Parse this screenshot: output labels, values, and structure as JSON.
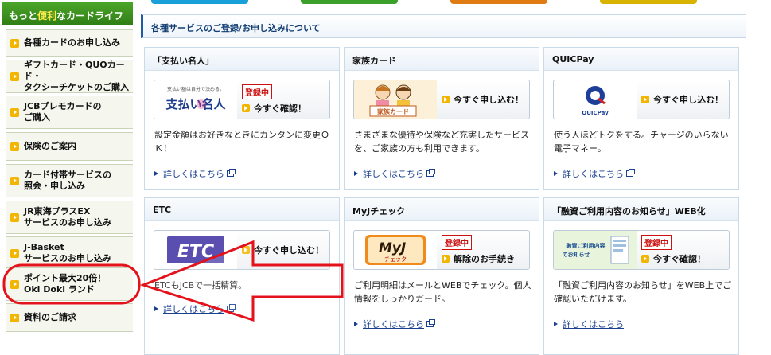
{
  "top_bars": [
    {
      "color": "#1aa0d8"
    },
    {
      "color": "#3aa02a"
    },
    {
      "color": "#e07a12"
    },
    {
      "color": "#d8b400"
    }
  ],
  "sidebar": {
    "header_prefix": "もっと",
    "header_highlight": "便利",
    "header_suffix": "なカードライフ",
    "items": [
      {
        "label": "各種カードのお申し込み"
      },
      {
        "label": "ギフトカード・QUOカード・\nタクシーチケットのご購入"
      },
      {
        "label": "JCBプレモカードの\nご購入"
      },
      {
        "label": "保険のご案内"
      },
      {
        "label": "カード付帯サービスの\n照会・申し込み"
      },
      {
        "label": "JR東海プラスEX\nサービスのお申し込み"
      },
      {
        "label": "J-Basket\nサービスのお申し込み"
      },
      {
        "label": "ポイント最大20倍！\nOki Doki ランド"
      },
      {
        "label": "資料のご請求"
      }
    ]
  },
  "main": {
    "title": "各種サービスのご登録/お申し込みについて",
    "cards": [
      {
        "title": "「支払い名人」",
        "logo_text": "支払い名人",
        "logo_tagline": "支払い額は自分で決める。",
        "badge": "登録中",
        "cta": "今すぐ確認！",
        "desc": "設定金額はお好きなときにカンタンに変更ＯＫ！",
        "link": "詳しくはこちら"
      },
      {
        "title": "家族カード",
        "logo_text": "家族カード",
        "badge": "",
        "cta": "今すぐ申し込む！",
        "desc": "さまざまな優待や保険など充実したサービスを、ご家族の方も利用できます。",
        "link": "詳しくはこちら"
      },
      {
        "title": "QUICPay",
        "logo_text": "QUICPay",
        "badge": "",
        "cta": "今すぐ申し込む！",
        "desc": "使う人ほどトクをする。チャージのいらない電子マネー。",
        "link": "詳しくはこちら"
      },
      {
        "title": "ETC",
        "logo_text": "ETC",
        "badge": "",
        "cta": "今すぐ申し込む！",
        "desc": "ETCもJCBで一括精算。",
        "link": "詳しくはこちら"
      },
      {
        "title": "MyJチェック",
        "logo_text": "MyJ",
        "logo_sub": "チェック",
        "badge": "登録中",
        "cta": "解除のお手続き",
        "desc": "ご利用明細はメールとWEBでチェック。個人情報をしっかりガード。",
        "link": "詳しくはこちら"
      },
      {
        "title": "「融資ご利用内容のお知らせ」WEB化",
        "logo_text": "融資ご利用内容\nのお知らせ",
        "badge": "登録中",
        "cta": "今すぐ確認！",
        "desc": "「融資ご利用内容のお知らせ」をWEB上でご確認いただけます。",
        "link": "詳しくはこちら"
      }
    ]
  },
  "annotation": {
    "color": "#e3121b"
  }
}
